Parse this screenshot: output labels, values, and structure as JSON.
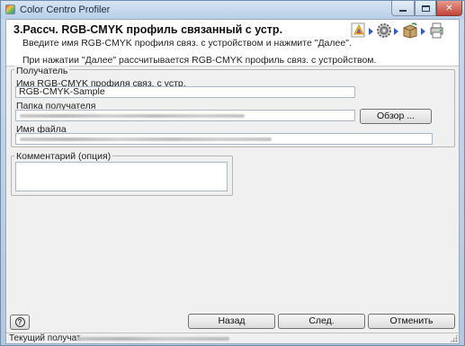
{
  "window": {
    "title": "Color Centro Profiler"
  },
  "header": {
    "step_title": "3.Рассч. RGB-CMYK профиль связанный с устр.",
    "description": "Введите имя RGB-CMYK профиля связ. с устройством и нажмите \"Далее\".",
    "note": "При нажатии \"Далее\" рассчитывается RGB-CMYK профиль связ. с устройством.",
    "workflow_icons": [
      "color-gamut-icon",
      "gear-icon",
      "package-icon",
      "printer-icon"
    ]
  },
  "recipient_group": {
    "legend": "Получатель",
    "profile_name_label": "Имя RGB-CMYK профиля связ. с устр.",
    "profile_name_value": "RGB-CMYK-Sample",
    "folder_label": "Папка получателя",
    "folder_value": "",
    "browse_label": "Обзор ...",
    "filename_label": "Имя файла",
    "filename_value": ""
  },
  "comment_group": {
    "legend": "Комментарий (опция)",
    "value": ""
  },
  "footer": {
    "help_label": "?",
    "back_label": "Назад",
    "next_label": "След.",
    "cancel_label": "Отменить"
  },
  "status_bar": {
    "label": "Текущий получат.",
    "value": ""
  },
  "colors": {
    "accent_arrow": "#2f5fb0",
    "close_button": "#c2443a"
  }
}
